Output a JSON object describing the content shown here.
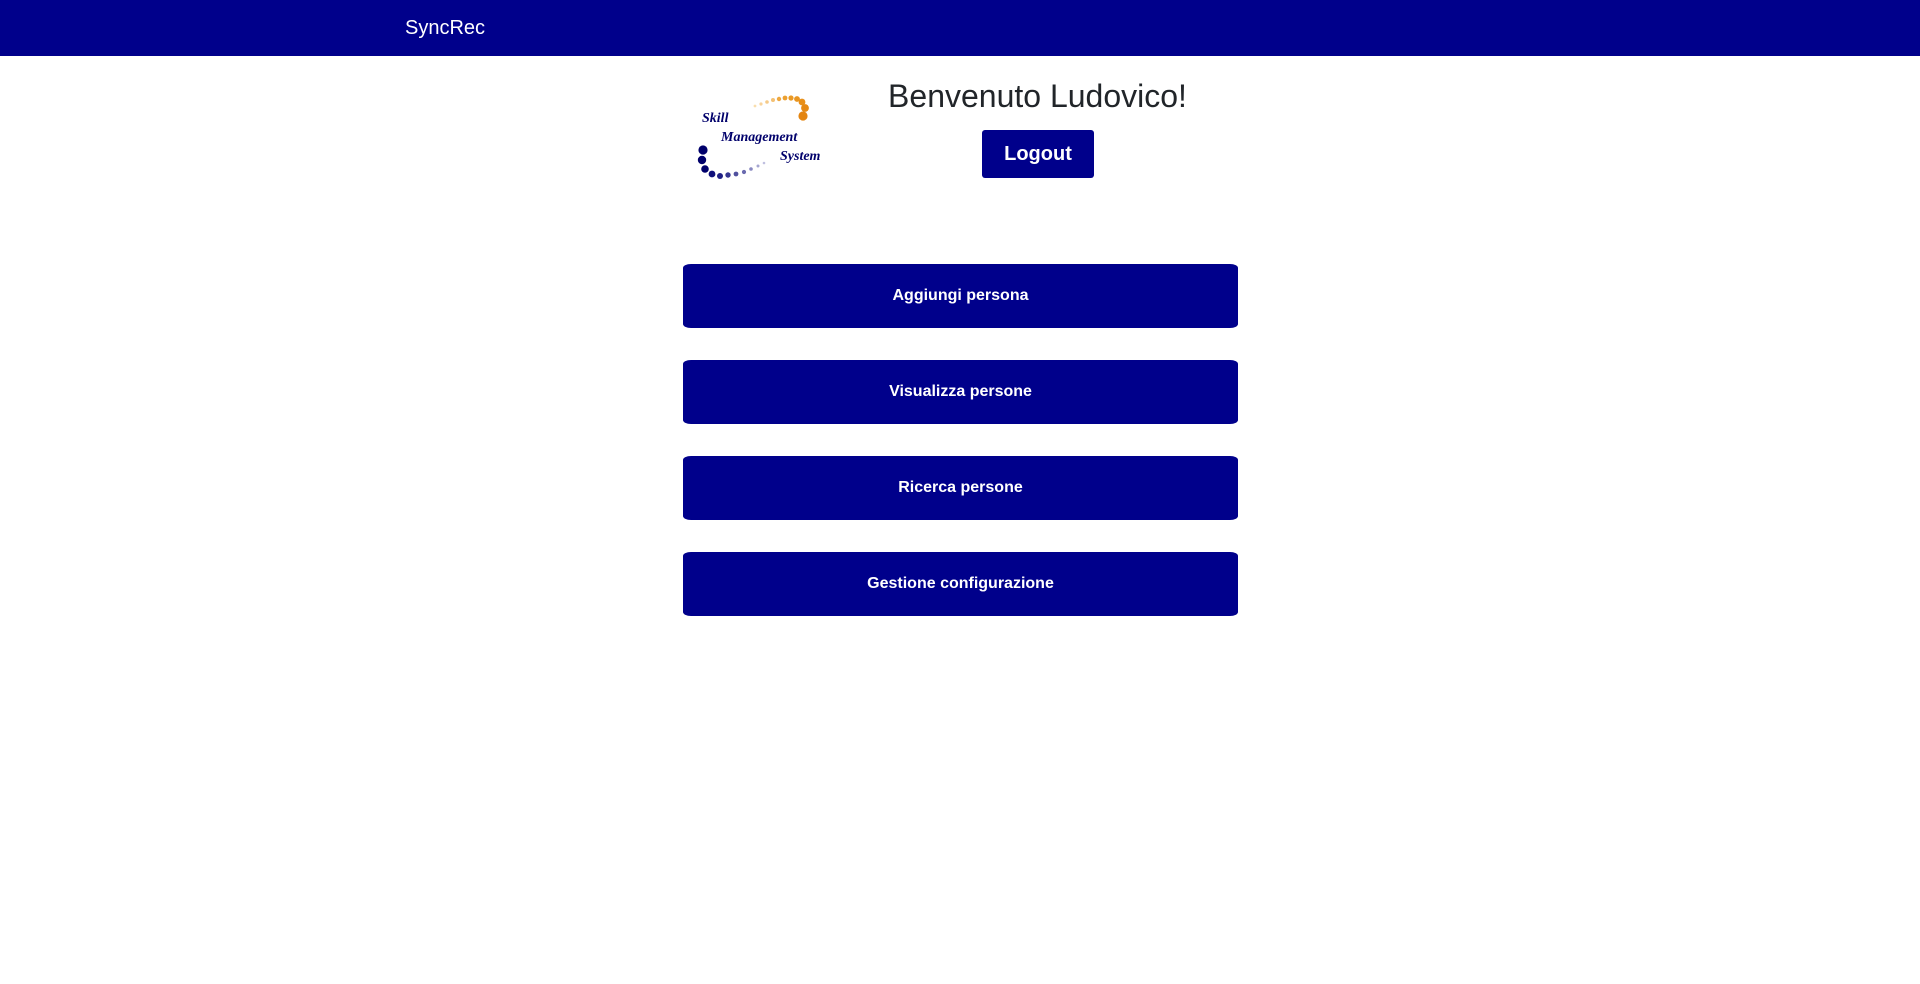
{
  "navbar": {
    "brand": "SyncRec",
    "color": "#00008b"
  },
  "logo": {
    "line1": "Skill",
    "line2": "Management",
    "line3": "System",
    "primary_color": "#00006b",
    "accent_color": "#f0a020"
  },
  "header": {
    "welcome": "Benvenuto Ludovico!",
    "logout_label": "Logout"
  },
  "menu": {
    "items": [
      {
        "label": "Aggiungi persona"
      },
      {
        "label": "Visualizza persone"
      },
      {
        "label": "Ricerca persone"
      },
      {
        "label": "Gestione configurazione"
      }
    ]
  }
}
